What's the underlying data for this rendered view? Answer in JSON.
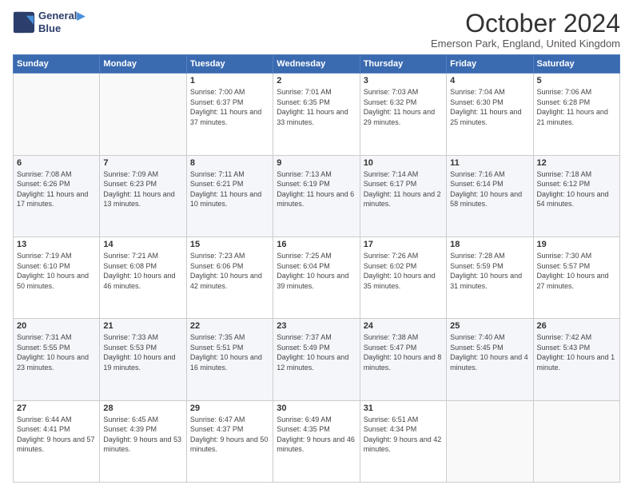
{
  "header": {
    "logo_line1": "General",
    "logo_line2": "Blue",
    "month": "October 2024",
    "location": "Emerson Park, England, United Kingdom"
  },
  "weekdays": [
    "Sunday",
    "Monday",
    "Tuesday",
    "Wednesday",
    "Thursday",
    "Friday",
    "Saturday"
  ],
  "weeks": [
    [
      {
        "day": "",
        "sunrise": "",
        "sunset": "",
        "daylight": ""
      },
      {
        "day": "",
        "sunrise": "",
        "sunset": "",
        "daylight": ""
      },
      {
        "day": "1",
        "sunrise": "Sunrise: 7:00 AM",
        "sunset": "Sunset: 6:37 PM",
        "daylight": "Daylight: 11 hours and 37 minutes."
      },
      {
        "day": "2",
        "sunrise": "Sunrise: 7:01 AM",
        "sunset": "Sunset: 6:35 PM",
        "daylight": "Daylight: 11 hours and 33 minutes."
      },
      {
        "day": "3",
        "sunrise": "Sunrise: 7:03 AM",
        "sunset": "Sunset: 6:32 PM",
        "daylight": "Daylight: 11 hours and 29 minutes."
      },
      {
        "day": "4",
        "sunrise": "Sunrise: 7:04 AM",
        "sunset": "Sunset: 6:30 PM",
        "daylight": "Daylight: 11 hours and 25 minutes."
      },
      {
        "day": "5",
        "sunrise": "Sunrise: 7:06 AM",
        "sunset": "Sunset: 6:28 PM",
        "daylight": "Daylight: 11 hours and 21 minutes."
      }
    ],
    [
      {
        "day": "6",
        "sunrise": "Sunrise: 7:08 AM",
        "sunset": "Sunset: 6:26 PM",
        "daylight": "Daylight: 11 hours and 17 minutes."
      },
      {
        "day": "7",
        "sunrise": "Sunrise: 7:09 AM",
        "sunset": "Sunset: 6:23 PM",
        "daylight": "Daylight: 11 hours and 13 minutes."
      },
      {
        "day": "8",
        "sunrise": "Sunrise: 7:11 AM",
        "sunset": "Sunset: 6:21 PM",
        "daylight": "Daylight: 11 hours and 10 minutes."
      },
      {
        "day": "9",
        "sunrise": "Sunrise: 7:13 AM",
        "sunset": "Sunset: 6:19 PM",
        "daylight": "Daylight: 11 hours and 6 minutes."
      },
      {
        "day": "10",
        "sunrise": "Sunrise: 7:14 AM",
        "sunset": "Sunset: 6:17 PM",
        "daylight": "Daylight: 11 hours and 2 minutes."
      },
      {
        "day": "11",
        "sunrise": "Sunrise: 7:16 AM",
        "sunset": "Sunset: 6:14 PM",
        "daylight": "Daylight: 10 hours and 58 minutes."
      },
      {
        "day": "12",
        "sunrise": "Sunrise: 7:18 AM",
        "sunset": "Sunset: 6:12 PM",
        "daylight": "Daylight: 10 hours and 54 minutes."
      }
    ],
    [
      {
        "day": "13",
        "sunrise": "Sunrise: 7:19 AM",
        "sunset": "Sunset: 6:10 PM",
        "daylight": "Daylight: 10 hours and 50 minutes."
      },
      {
        "day": "14",
        "sunrise": "Sunrise: 7:21 AM",
        "sunset": "Sunset: 6:08 PM",
        "daylight": "Daylight: 10 hours and 46 minutes."
      },
      {
        "day": "15",
        "sunrise": "Sunrise: 7:23 AM",
        "sunset": "Sunset: 6:06 PM",
        "daylight": "Daylight: 10 hours and 42 minutes."
      },
      {
        "day": "16",
        "sunrise": "Sunrise: 7:25 AM",
        "sunset": "Sunset: 6:04 PM",
        "daylight": "Daylight: 10 hours and 39 minutes."
      },
      {
        "day": "17",
        "sunrise": "Sunrise: 7:26 AM",
        "sunset": "Sunset: 6:02 PM",
        "daylight": "Daylight: 10 hours and 35 minutes."
      },
      {
        "day": "18",
        "sunrise": "Sunrise: 7:28 AM",
        "sunset": "Sunset: 5:59 PM",
        "daylight": "Daylight: 10 hours and 31 minutes."
      },
      {
        "day": "19",
        "sunrise": "Sunrise: 7:30 AM",
        "sunset": "Sunset: 5:57 PM",
        "daylight": "Daylight: 10 hours and 27 minutes."
      }
    ],
    [
      {
        "day": "20",
        "sunrise": "Sunrise: 7:31 AM",
        "sunset": "Sunset: 5:55 PM",
        "daylight": "Daylight: 10 hours and 23 minutes."
      },
      {
        "day": "21",
        "sunrise": "Sunrise: 7:33 AM",
        "sunset": "Sunset: 5:53 PM",
        "daylight": "Daylight: 10 hours and 19 minutes."
      },
      {
        "day": "22",
        "sunrise": "Sunrise: 7:35 AM",
        "sunset": "Sunset: 5:51 PM",
        "daylight": "Daylight: 10 hours and 16 minutes."
      },
      {
        "day": "23",
        "sunrise": "Sunrise: 7:37 AM",
        "sunset": "Sunset: 5:49 PM",
        "daylight": "Daylight: 10 hours and 12 minutes."
      },
      {
        "day": "24",
        "sunrise": "Sunrise: 7:38 AM",
        "sunset": "Sunset: 5:47 PM",
        "daylight": "Daylight: 10 hours and 8 minutes."
      },
      {
        "day": "25",
        "sunrise": "Sunrise: 7:40 AM",
        "sunset": "Sunset: 5:45 PM",
        "daylight": "Daylight: 10 hours and 4 minutes."
      },
      {
        "day": "26",
        "sunrise": "Sunrise: 7:42 AM",
        "sunset": "Sunset: 5:43 PM",
        "daylight": "Daylight: 10 hours and 1 minute."
      }
    ],
    [
      {
        "day": "27",
        "sunrise": "Sunrise: 6:44 AM",
        "sunset": "Sunset: 4:41 PM",
        "daylight": "Daylight: 9 hours and 57 minutes."
      },
      {
        "day": "28",
        "sunrise": "Sunrise: 6:45 AM",
        "sunset": "Sunset: 4:39 PM",
        "daylight": "Daylight: 9 hours and 53 minutes."
      },
      {
        "day": "29",
        "sunrise": "Sunrise: 6:47 AM",
        "sunset": "Sunset: 4:37 PM",
        "daylight": "Daylight: 9 hours and 50 minutes."
      },
      {
        "day": "30",
        "sunrise": "Sunrise: 6:49 AM",
        "sunset": "Sunset: 4:35 PM",
        "daylight": "Daylight: 9 hours and 46 minutes."
      },
      {
        "day": "31",
        "sunrise": "Sunrise: 6:51 AM",
        "sunset": "Sunset: 4:34 PM",
        "daylight": "Daylight: 9 hours and 42 minutes."
      },
      {
        "day": "",
        "sunrise": "",
        "sunset": "",
        "daylight": ""
      },
      {
        "day": "",
        "sunrise": "",
        "sunset": "",
        "daylight": ""
      }
    ]
  ]
}
